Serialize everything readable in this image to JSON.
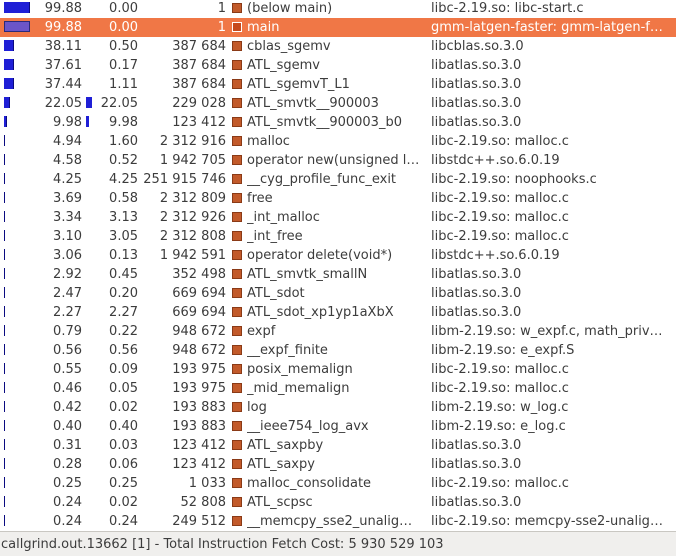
{
  "selected_index": 1,
  "bar_color": "#1f1fd6",
  "selection_color": "#f07746",
  "function_icon": "function-square-icon",
  "rows": [
    {
      "incl": "99.88",
      "incl_frac": 0.9988,
      "self": "0.00",
      "self_frac": 0.0,
      "called": "1",
      "function": "(below main)",
      "location": "libc-2.19.so: libc-start.c"
    },
    {
      "incl": "99.88",
      "incl_frac": 0.9988,
      "self": "0.00",
      "self_frac": 0.0,
      "called": "1",
      "function": "main",
      "location": "gmm-latgen-faster: gmm-latgen-f…"
    },
    {
      "incl": "38.11",
      "incl_frac": 0.3811,
      "self": "0.50",
      "self_frac": 0.005,
      "called": "387 684",
      "function": "cblas_sgemv",
      "location": "libcblas.so.3.0"
    },
    {
      "incl": "37.61",
      "incl_frac": 0.3761,
      "self": "0.17",
      "self_frac": 0.0017,
      "called": "387 684",
      "function": "ATL_sgemv",
      "location": "libatlas.so.3.0"
    },
    {
      "incl": "37.44",
      "incl_frac": 0.3744,
      "self": "1.11",
      "self_frac": 0.0111,
      "called": "387 684",
      "function": "ATL_sgemvT_L1",
      "location": "libatlas.so.3.0"
    },
    {
      "incl": "22.05",
      "incl_frac": 0.2205,
      "self": "22.05",
      "self_frac": 0.2205,
      "called": "229 028",
      "function": "ATL_smvtk__900003",
      "location": "libatlas.so.3.0"
    },
    {
      "incl": "9.98",
      "incl_frac": 0.0998,
      "self": "9.98",
      "self_frac": 0.0998,
      "called": "123 412",
      "function": "ATL_smvtk__900003_b0",
      "location": "libatlas.so.3.0"
    },
    {
      "incl": "4.94",
      "incl_frac": 0.0494,
      "self": "1.60",
      "self_frac": 0.016,
      "called": "2 312 916",
      "function": "malloc",
      "location": "libc-2.19.so: malloc.c"
    },
    {
      "incl": "4.58",
      "incl_frac": 0.0458,
      "self": "0.52",
      "self_frac": 0.0052,
      "called": "1 942 705",
      "function": "operator new(unsigned l…",
      "location": "libstdc++.so.6.0.19"
    },
    {
      "incl": "4.25",
      "incl_frac": 0.0425,
      "self": "4.25",
      "self_frac": 0.0425,
      "called": "251 915 746",
      "function": "__cyg_profile_func_exit",
      "location": "libc-2.19.so: noophooks.c"
    },
    {
      "incl": "3.69",
      "incl_frac": 0.0369,
      "self": "0.58",
      "self_frac": 0.0058,
      "called": "2 312 809",
      "function": "free",
      "location": "libc-2.19.so: malloc.c"
    },
    {
      "incl": "3.34",
      "incl_frac": 0.0334,
      "self": "3.13",
      "self_frac": 0.0313,
      "called": "2 312 926",
      "function": "_int_malloc",
      "location": "libc-2.19.so: malloc.c"
    },
    {
      "incl": "3.10",
      "incl_frac": 0.031,
      "self": "3.05",
      "self_frac": 0.0305,
      "called": "2 312 808",
      "function": "_int_free",
      "location": "libc-2.19.so: malloc.c"
    },
    {
      "incl": "3.06",
      "incl_frac": 0.0306,
      "self": "0.13",
      "self_frac": 0.0013,
      "called": "1 942 591",
      "function": "operator delete(void*)",
      "location": "libstdc++.so.6.0.19"
    },
    {
      "incl": "2.92",
      "incl_frac": 0.0292,
      "self": "0.45",
      "self_frac": 0.0045,
      "called": "352 498",
      "function": "ATL_smvtk_smallN",
      "location": "libatlas.so.3.0"
    },
    {
      "incl": "2.47",
      "incl_frac": 0.0247,
      "self": "0.20",
      "self_frac": 0.002,
      "called": "669 694",
      "function": "ATL_sdot",
      "location": "libatlas.so.3.0"
    },
    {
      "incl": "2.27",
      "incl_frac": 0.0227,
      "self": "2.27",
      "self_frac": 0.0227,
      "called": "669 694",
      "function": "ATL_sdot_xp1yp1aXbX",
      "location": "libatlas.so.3.0"
    },
    {
      "incl": "0.79",
      "incl_frac": 0.0079,
      "self": "0.22",
      "self_frac": 0.0022,
      "called": "948 672",
      "function": "expf",
      "location": "libm-2.19.so: w_expf.c, math_priv…"
    },
    {
      "incl": "0.56",
      "incl_frac": 0.0056,
      "self": "0.56",
      "self_frac": 0.0056,
      "called": "948 672",
      "function": "__expf_finite",
      "location": "libm-2.19.so: e_expf.S"
    },
    {
      "incl": "0.55",
      "incl_frac": 0.0055,
      "self": "0.09",
      "self_frac": 0.0009,
      "called": "193 975",
      "function": "posix_memalign",
      "location": "libc-2.19.so: malloc.c"
    },
    {
      "incl": "0.46",
      "incl_frac": 0.0046,
      "self": "0.05",
      "self_frac": 0.0005,
      "called": "193 975",
      "function": "_mid_memalign",
      "location": "libc-2.19.so: malloc.c"
    },
    {
      "incl": "0.42",
      "incl_frac": 0.0042,
      "self": "0.02",
      "self_frac": 0.0002,
      "called": "193 883",
      "function": "log",
      "location": "libm-2.19.so: w_log.c"
    },
    {
      "incl": "0.40",
      "incl_frac": 0.004,
      "self": "0.40",
      "self_frac": 0.004,
      "called": "193 883",
      "function": "__ieee754_log_avx",
      "location": "libm-2.19.so: e_log.c"
    },
    {
      "incl": "0.31",
      "incl_frac": 0.0031,
      "self": "0.03",
      "self_frac": 0.0003,
      "called": "123 412",
      "function": "ATL_saxpby",
      "location": "libatlas.so.3.0"
    },
    {
      "incl": "0.28",
      "incl_frac": 0.0028,
      "self": "0.06",
      "self_frac": 0.0006,
      "called": "123 412",
      "function": "ATL_saxpy",
      "location": "libatlas.so.3.0"
    },
    {
      "incl": "0.25",
      "incl_frac": 0.0025,
      "self": "0.25",
      "self_frac": 0.0025,
      "called": "1 033",
      "function": "malloc_consolidate",
      "location": "libc-2.19.so: malloc.c"
    },
    {
      "incl": "0.24",
      "incl_frac": 0.0024,
      "self": "0.02",
      "self_frac": 0.0002,
      "called": "52 808",
      "function": "ATL_scpsc",
      "location": "libatlas.so.3.0"
    },
    {
      "incl": "0.24",
      "incl_frac": 0.0024,
      "self": "0.24",
      "self_frac": 0.0024,
      "called": "249 512",
      "function": "__memcpy_sse2_unalig…",
      "location": "libc-2.19.so: memcpy-sse2-unalign…"
    }
  ],
  "status": {
    "text": "callgrind.out.13662 [1] - Total Instruction Fetch Cost: 5 930 529 103"
  }
}
